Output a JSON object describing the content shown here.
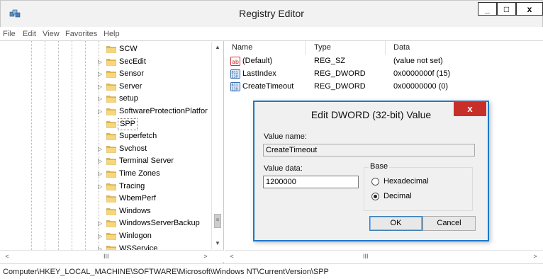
{
  "window": {
    "title": "Registry Editor",
    "min_label": "_",
    "max_label": "□",
    "close_label": "x",
    "app_icon": "registry-icon"
  },
  "menu": {
    "items": [
      "File",
      "Edit",
      "View",
      "Favorites",
      "Help"
    ]
  },
  "tree": {
    "items": [
      {
        "label": "SCW",
        "expandable": false
      },
      {
        "label": "SecEdit",
        "expandable": true
      },
      {
        "label": "Sensor",
        "expandable": true
      },
      {
        "label": "Server",
        "expandable": true
      },
      {
        "label": "setup",
        "expandable": true
      },
      {
        "label": "SoftwareProtectionPlatfor",
        "expandable": true
      },
      {
        "label": "SPP",
        "expandable": false,
        "selected": true
      },
      {
        "label": "Superfetch",
        "expandable": false
      },
      {
        "label": "Svchost",
        "expandable": true
      },
      {
        "label": "Terminal Server",
        "expandable": true
      },
      {
        "label": "Time Zones",
        "expandable": true
      },
      {
        "label": "Tracing",
        "expandable": true
      },
      {
        "label": "WbemPerf",
        "expandable": false
      },
      {
        "label": "Windows",
        "expandable": false
      },
      {
        "label": "WindowsServerBackup",
        "expandable": true
      },
      {
        "label": "Winlogon",
        "expandable": true
      },
      {
        "label": "WSService",
        "expandable": true
      }
    ],
    "hscroll_mid": "III"
  },
  "list": {
    "headers": {
      "name": "Name",
      "type": "Type",
      "data": "Data"
    },
    "rows": [
      {
        "name": "(Default)",
        "type": "REG_SZ",
        "data": "(value not set)",
        "icon": "string-value-icon"
      },
      {
        "name": "LastIndex",
        "type": "REG_DWORD",
        "data": "0x0000000f (15)",
        "icon": "dword-value-icon"
      },
      {
        "name": "CreateTimeout",
        "type": "REG_DWORD",
        "data": "0x00000000 (0)",
        "icon": "dword-value-icon"
      }
    ],
    "hscroll_mid": "III"
  },
  "status": {
    "path": "Computer\\HKEY_LOCAL_MACHINE\\SOFTWARE\\Microsoft\\Windows NT\\CurrentVersion\\SPP"
  },
  "dialog": {
    "title": "Edit DWORD (32-bit) Value",
    "close_label": "x",
    "value_name_label": "Value name:",
    "value_name": "CreateTimeout",
    "value_data_label": "Value data:",
    "value_data": "1200000",
    "base_label": "Base",
    "base_options": [
      "Hexadecimal",
      "Decimal"
    ],
    "base_selected": "Decimal",
    "ok_label": "OK",
    "cancel_label": "Cancel"
  }
}
